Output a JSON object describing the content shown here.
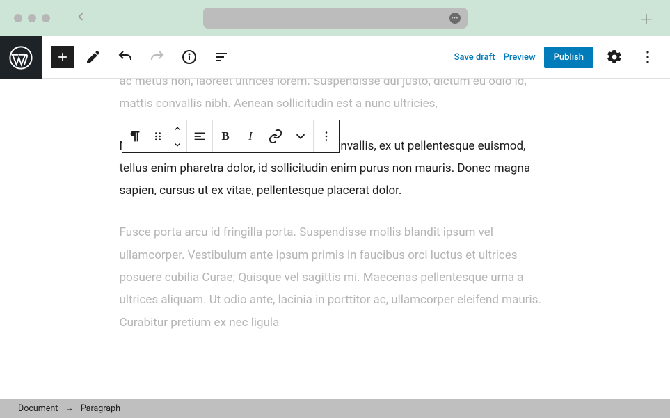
{
  "topbar": {
    "save_draft": "Save draft",
    "preview": "Preview",
    "publish": "Publish"
  },
  "content": {
    "para_top": "ac metus non, laoreet ultrices lorem. Suspendisse dui justo, dictum eu odio id, mattis convallis nibh. Aenean sollicitudin est a nunc ultricies,",
    "para_active": "Nam elementum fringilla laoreet. Etiam convallis, ex ut pellentesque euismod, tellus enim pharetra dolor, id sollicitudin enim purus non mauris. Donec magna sapien, cursus ut ex vitae, pellentesque placerat dolor.",
    "para_below": "Fusce porta arcu id fringilla porta. Suspendisse mollis blandit ipsum vel ullamcorper. Vestibulum ante ipsum primis in faucibus orci luctus et ultrices posuere cubilia Curae; Quisque vel sagittis mi. Maecenas pellentesque urna a ultrices aliquam. Ut odio ante, lacinia in porttitor ac, ullamcorper eleifend mauris. Curabitur pretium ex nec ligula"
  },
  "block_toolbar": {
    "bold": "B",
    "italic": "I"
  },
  "breadcrumb": {
    "root": "Document",
    "arrow": "→",
    "leaf": "Paragraph"
  }
}
